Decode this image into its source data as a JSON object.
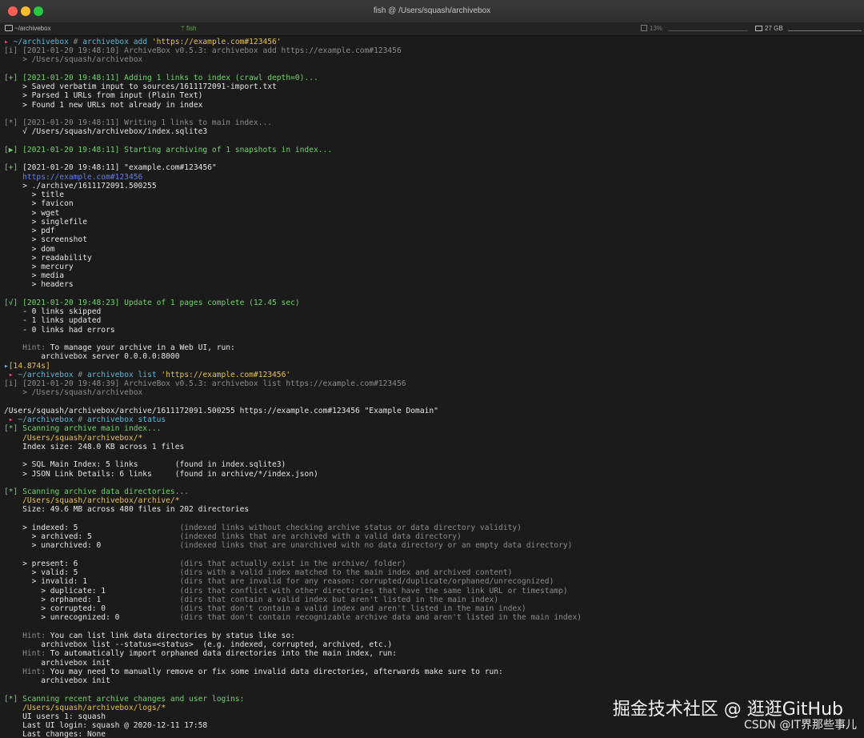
{
  "window": {
    "title": "fish  @  /Users/squash/archivebox",
    "tab_dir": "~/archivebox",
    "tab_proc": "fish",
    "cpu": "13%",
    "mem": "27 GB"
  },
  "watermark": {
    "main": "掘金技术社区 @ 逛逛GitHub",
    "sub": "CSDN @IT界那些事儿"
  },
  "colors": {
    "green": "#6fd46b",
    "yellow": "#e6c24a",
    "pink": "#e0508a",
    "cyan": "#5fb8d6",
    "muted": "#8c8c8c"
  },
  "lines": [
    {
      "segs": [
        {
          "t": "▸ ",
          "c": "c-pink"
        },
        {
          "t": "~/archivebox ",
          "c": "c-cyan"
        },
        {
          "t": "# ",
          "c": "c-muted"
        },
        {
          "t": "archivebox add ",
          "c": "c-cyan"
        },
        {
          "t": "'https://example.com#123456'",
          "c": "c-yellow"
        }
      ]
    },
    {
      "segs": [
        {
          "t": "[i] [2021-01-20 19:48:10] ArchiveBox v0.5.3: archivebox add https://example.com#123456",
          "c": "c-muted"
        }
      ]
    },
    {
      "segs": [
        {
          "t": "    > /Users/squash/archivebox",
          "c": "c-muted"
        }
      ]
    },
    {
      "segs": []
    },
    {
      "segs": [
        {
          "t": "[+] [2021-01-20 19:48:11] Adding 1 links to index (crawl depth=0)...",
          "c": "c-green"
        }
      ]
    },
    {
      "segs": [
        {
          "t": "    > Saved verbatim input to sources/1611172091-import.txt",
          "c": "c-white"
        }
      ]
    },
    {
      "segs": [
        {
          "t": "    > Parsed 1 URLs from input (Plain Text)",
          "c": "c-white"
        }
      ]
    },
    {
      "segs": [
        {
          "t": "    > Found 1 new URLs not already in index",
          "c": "c-white"
        }
      ]
    },
    {
      "segs": []
    },
    {
      "segs": [
        {
          "t": "[*] [2021-01-20 19:48:11] Writing 1 links to main index...",
          "c": "c-muted"
        }
      ]
    },
    {
      "segs": [
        {
          "t": "    √ /Users/squash/archivebox/index.sqlite3",
          "c": "c-white"
        }
      ]
    },
    {
      "segs": []
    },
    {
      "segs": [
        {
          "t": "[▶] [2021-01-20 19:48:11] Starting archiving of 1 snapshots in index...",
          "c": "c-green"
        }
      ]
    },
    {
      "segs": []
    },
    {
      "segs": [
        {
          "t": "[+] ",
          "c": "c-green"
        },
        {
          "t": "[2021-01-20 19:48:11] \"example.com#123456\"",
          "c": "c-white"
        }
      ]
    },
    {
      "segs": [
        {
          "t": "    https://example.com#123456",
          "c": "c-blue"
        }
      ]
    },
    {
      "segs": [
        {
          "t": "    > ./archive/1611172091.500255",
          "c": "c-white"
        }
      ]
    },
    {
      "segs": [
        {
          "t": "      > title",
          "c": "c-white"
        }
      ]
    },
    {
      "segs": [
        {
          "t": "      > favicon",
          "c": "c-white"
        }
      ]
    },
    {
      "segs": [
        {
          "t": "      > wget",
          "c": "c-white"
        }
      ]
    },
    {
      "segs": [
        {
          "t": "      > singlefile",
          "c": "c-white"
        }
      ]
    },
    {
      "segs": [
        {
          "t": "      > pdf",
          "c": "c-white"
        }
      ]
    },
    {
      "segs": [
        {
          "t": "      > screenshot",
          "c": "c-white"
        }
      ]
    },
    {
      "segs": [
        {
          "t": "      > dom",
          "c": "c-white"
        }
      ]
    },
    {
      "segs": [
        {
          "t": "      > readability",
          "c": "c-white"
        }
      ]
    },
    {
      "segs": [
        {
          "t": "      > mercury",
          "c": "c-white"
        }
      ]
    },
    {
      "segs": [
        {
          "t": "      > media",
          "c": "c-white"
        }
      ]
    },
    {
      "segs": [
        {
          "t": "      > headers",
          "c": "c-white"
        }
      ]
    },
    {
      "segs": []
    },
    {
      "segs": [
        {
          "t": "[√] [2021-01-20 19:48:23] Update of 1 pages complete (12.45 sec)",
          "c": "c-green"
        }
      ]
    },
    {
      "segs": [
        {
          "t": "    - 0 links skipped",
          "c": "c-white"
        }
      ]
    },
    {
      "segs": [
        {
          "t": "    - 1 links updated",
          "c": "c-white"
        }
      ]
    },
    {
      "segs": [
        {
          "t": "    - 0 links had errors",
          "c": "c-white"
        }
      ]
    },
    {
      "segs": []
    },
    {
      "segs": [
        {
          "t": "    Hint: ",
          "c": "c-muted"
        },
        {
          "t": "To manage your archive in a Web UI, run:",
          "c": "c-white"
        }
      ]
    },
    {
      "segs": [
        {
          "t": "        archivebox server 0.0.0.0:8000",
          "c": "c-white"
        }
      ]
    },
    {
      "segs": [
        {
          "t": "▸",
          "c": "c-cyan"
        },
        {
          "t": "[14.874s]",
          "c": "c-yellow"
        }
      ]
    },
    {
      "segs": [
        {
          "t": " ▸ ",
          "c": "c-pink"
        },
        {
          "t": "~/archivebox ",
          "c": "c-cyan"
        },
        {
          "t": "# ",
          "c": "c-muted"
        },
        {
          "t": "archivebox list ",
          "c": "c-cyan"
        },
        {
          "t": "'https://example.com#123456'",
          "c": "c-yellow"
        }
      ]
    },
    {
      "segs": [
        {
          "t": "[i] [2021-01-20 19:48:39] ArchiveBox v0.5.3: archivebox list https://example.com#123456",
          "c": "c-muted"
        }
      ]
    },
    {
      "segs": [
        {
          "t": "    > /Users/squash/archivebox",
          "c": "c-muted"
        }
      ]
    },
    {
      "segs": []
    },
    {
      "segs": [
        {
          "t": "/Users/squash/archivebox/archive/1611172091.500255 https://example.com#123456 \"Example Domain\"",
          "c": "c-white"
        }
      ]
    },
    {
      "segs": [
        {
          "t": " ▸ ",
          "c": "c-pink"
        },
        {
          "t": "~/archivebox ",
          "c": "c-cyan"
        },
        {
          "t": "# ",
          "c": "c-muted"
        },
        {
          "t": "archivebox status",
          "c": "c-cyan"
        }
      ]
    },
    {
      "segs": [
        {
          "t": "[*] Scanning archive main index...",
          "c": "c-green"
        }
      ]
    },
    {
      "segs": [
        {
          "t": "    /Users/squash/archivebox/*",
          "c": "c-yellow"
        }
      ]
    },
    {
      "segs": [
        {
          "t": "    Index size: 248.0 KB across 1 files",
          "c": "c-white"
        }
      ]
    },
    {
      "segs": []
    },
    {
      "segs": [
        {
          "t": "    > SQL Main Index: 5 links        (found in index.sqlite3)",
          "c": "c-white"
        }
      ]
    },
    {
      "segs": [
        {
          "t": "    > JSON Link Details: 6 links     (found in archive/*/index.json)",
          "c": "c-white"
        }
      ]
    },
    {
      "segs": []
    },
    {
      "segs": [
        {
          "t": "[*] Scanning archive data directories...",
          "c": "c-green"
        }
      ]
    },
    {
      "segs": [
        {
          "t": "    /Users/squash/archivebox/archive/*",
          "c": "c-yellow"
        }
      ]
    },
    {
      "segs": [
        {
          "t": "    Size: 49.6 MB across 480 files in 202 directories",
          "c": "c-white"
        }
      ]
    },
    {
      "segs": []
    },
    {
      "segs": [
        {
          "t": "    > indexed: 5                      ",
          "c": "c-white"
        },
        {
          "t": "(indexed links without checking archive status or data directory validity)",
          "c": "c-muted"
        }
      ]
    },
    {
      "segs": [
        {
          "t": "      > archived: 5                   ",
          "c": "c-white"
        },
        {
          "t": "(indexed links that are archived with a valid data directory)",
          "c": "c-muted"
        }
      ]
    },
    {
      "segs": [
        {
          "t": "      > unarchived: 0                 ",
          "c": "c-white"
        },
        {
          "t": "(indexed links that are unarchived with no data directory or an empty data directory)",
          "c": "c-muted"
        }
      ]
    },
    {
      "segs": []
    },
    {
      "segs": [
        {
          "t": "    > present: 6                      ",
          "c": "c-white"
        },
        {
          "t": "(dirs that actually exist in the archive/ folder)",
          "c": "c-muted"
        }
      ]
    },
    {
      "segs": [
        {
          "t": "      > valid: 5                      ",
          "c": "c-white"
        },
        {
          "t": "(dirs with a valid index matched to the main index and archived content)",
          "c": "c-muted"
        }
      ]
    },
    {
      "segs": [
        {
          "t": "      > invalid: 1                    ",
          "c": "c-white"
        },
        {
          "t": "(dirs that are invalid for any reason: corrupted/duplicate/orphaned/unrecognized)",
          "c": "c-muted"
        }
      ]
    },
    {
      "segs": [
        {
          "t": "        > duplicate: 1                ",
          "c": "c-white"
        },
        {
          "t": "(dirs that conflict with other directories that have the same link URL or timestamp)",
          "c": "c-muted"
        }
      ]
    },
    {
      "segs": [
        {
          "t": "        > orphaned: 1                 ",
          "c": "c-white"
        },
        {
          "t": "(dirs that contain a valid index but aren't listed in the main index)",
          "c": "c-muted"
        }
      ]
    },
    {
      "segs": [
        {
          "t": "        > corrupted: 0                ",
          "c": "c-white"
        },
        {
          "t": "(dirs that don't contain a valid index and aren't listed in the main index)",
          "c": "c-muted"
        }
      ]
    },
    {
      "segs": [
        {
          "t": "        > unrecognized: 0             ",
          "c": "c-white"
        },
        {
          "t": "(dirs that don't contain recognizable archive data and aren't listed in the main index)",
          "c": "c-muted"
        }
      ]
    },
    {
      "segs": []
    },
    {
      "segs": [
        {
          "t": "    Hint: ",
          "c": "c-muted"
        },
        {
          "t": "You can list link data directories by status like so:",
          "c": "c-white"
        }
      ]
    },
    {
      "segs": [
        {
          "t": "        archivebox list --status=<status>  (e.g. indexed, corrupted, archived, etc.)",
          "c": "c-white"
        }
      ]
    },
    {
      "segs": [
        {
          "t": "    Hint: ",
          "c": "c-muted"
        },
        {
          "t": "To automatically import orphaned data directories into the main index, run:",
          "c": "c-white"
        }
      ]
    },
    {
      "segs": [
        {
          "t": "        archivebox init",
          "c": "c-white"
        }
      ]
    },
    {
      "segs": [
        {
          "t": "    Hint: ",
          "c": "c-muted"
        },
        {
          "t": "You may need to manually remove or fix some invalid data directories, afterwards make sure to run:",
          "c": "c-white"
        }
      ]
    },
    {
      "segs": [
        {
          "t": "        archivebox init",
          "c": "c-white"
        }
      ]
    },
    {
      "segs": []
    },
    {
      "segs": [
        {
          "t": "[*] Scanning recent archive changes and user logins:",
          "c": "c-green"
        }
      ]
    },
    {
      "segs": [
        {
          "t": "    /Users/squash/archivebox/logs/*",
          "c": "c-yellow"
        }
      ]
    },
    {
      "segs": [
        {
          "t": "    UI users 1: squash",
          "c": "c-white"
        }
      ]
    },
    {
      "segs": [
        {
          "t": "    Last UI login: squash @ 2020-12-11 17:58",
          "c": "c-white"
        }
      ]
    },
    {
      "segs": [
        {
          "t": "    Last changes: None",
          "c": "c-white"
        }
      ]
    }
  ]
}
